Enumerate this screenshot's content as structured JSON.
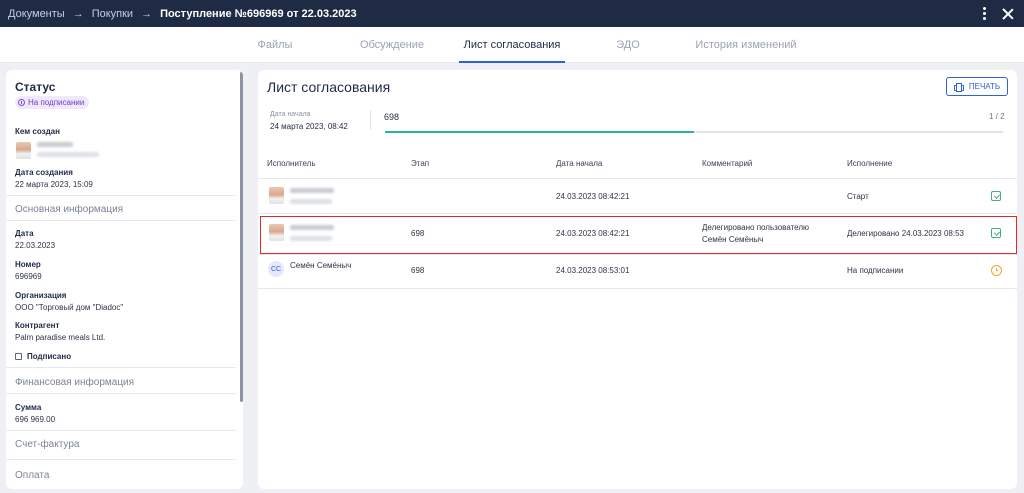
{
  "breadcrumb": {
    "items": [
      "Документы",
      "Покупки"
    ],
    "current": "Поступление №696969 от 22.03.2023"
  },
  "tabs": [
    {
      "label": "Файлы",
      "active": false
    },
    {
      "label": "Обсуждение",
      "active": false
    },
    {
      "label": "Лист согласования",
      "active": true
    },
    {
      "label": "ЭДО",
      "active": false
    },
    {
      "label": "История изменений",
      "active": false
    }
  ],
  "left": {
    "status_title": "Статус",
    "status_badge": "На подписании",
    "created_by_label": "Кем создан",
    "created_date_label": "Дата создания",
    "created_date": "22 марта 2023, 15:09",
    "main_info_section": "Основная информация",
    "date_label": "Дата",
    "date": "22.03.2023",
    "number_label": "Номер",
    "number": "696969",
    "org_label": "Организация",
    "org": "ООО \"Торговый дом \"Diadoc\"",
    "contractor_label": "Контрагент",
    "contractor": "Palm paradise meals Ltd.",
    "signed_label": "Подписано",
    "finance_section": "Финансовая информация",
    "sum_label": "Сумма",
    "sum": "696 969.00",
    "invoice_section": "Счет-фактура",
    "payment_section": "Оплата"
  },
  "right": {
    "title": "Лист согласования",
    "print_label": "ПЕЧАТЬ",
    "start_label": "Дата начала",
    "start_value": "24 марта 2023, 08:42",
    "stage": "698",
    "pager": "1 / 2",
    "progress": 0.5,
    "columns": [
      "Исполнитель",
      "Этап",
      "Дата начала",
      "Комментарий",
      "Исполнение"
    ],
    "rows": [
      {
        "executor": "",
        "stage": "",
        "start": "24.03.2023 08:42:21",
        "comment": "",
        "comment2": "",
        "result": "Старт",
        "icon": "check-icon"
      },
      {
        "executor": "",
        "stage": "698",
        "start": "24.03.2023 08:42:21",
        "comment": "Делегировано пользователю",
        "comment2": "Семён Семёныч",
        "result": "Делегировано 24.03.2023 08:53",
        "icon": "check-icon"
      },
      {
        "executor": "Семён Семёныч",
        "initials": "СС",
        "stage": "698",
        "start": "24.03.2023 08:53:01",
        "comment": "",
        "comment2": "",
        "result": "На подписании",
        "icon": "clock-icon"
      }
    ]
  },
  "colors": {
    "topbar": "#1f2a44",
    "accent": "#2f62d8",
    "progress": "#2bb39a",
    "highlight": "#e0292b",
    "ok": "#3fb27a",
    "pending": "#f5a623"
  }
}
